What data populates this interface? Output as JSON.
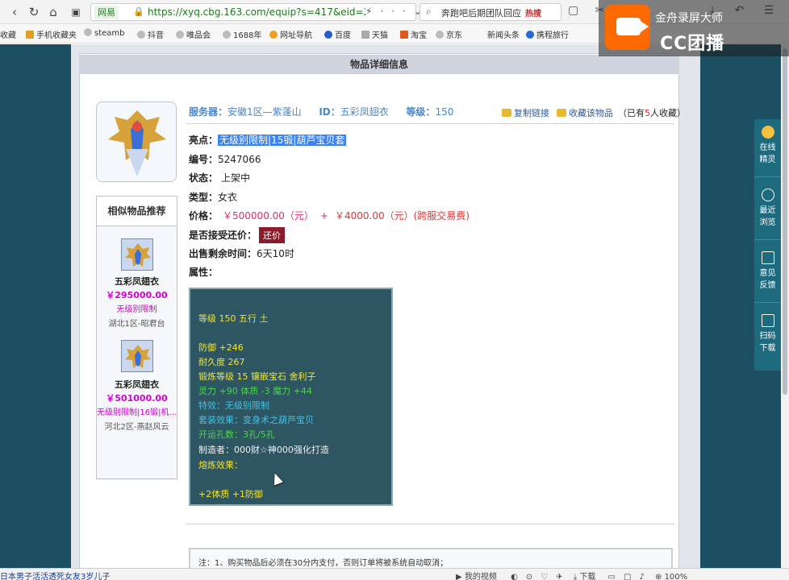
{
  "browser": {
    "url_site": "网易",
    "url": "https://xyq.cbg.163.com/equip?s=417&eid=2",
    "search_text": "奔跑吧后期团队回应",
    "search_hot": "热搜",
    "back_icon": "‹",
    "refresh_icon": "↻",
    "home_icon": "⌂"
  },
  "bookmarks": [
    {
      "label": "收藏",
      "color": "#666"
    },
    {
      "label": "手机收藏夹",
      "color": "#e0a020"
    },
    {
      "label": "steamb",
      "color": "#777"
    },
    {
      "label": "抖音",
      "color": "#777"
    },
    {
      "label": "唯品会",
      "color": "#777"
    },
    {
      "label": "1688年",
      "color": "#777"
    },
    {
      "label": "网址导航",
      "color": "#f0a020"
    },
    {
      "label": "百度",
      "color": "#2a5ad0"
    },
    {
      "label": "天猫",
      "color": "#888"
    },
    {
      "label": "淘宝",
      "color": "#e05a20"
    },
    {
      "label": "京东",
      "color": "#777"
    },
    {
      "label": "新闻头条",
      "color": "#777"
    },
    {
      "label": "携程旅行",
      "color": "#2a6ad0"
    }
  ],
  "recorder": {
    "title": "金舟录屏大师",
    "brand": "CC团播"
  },
  "panel": {
    "title": "物品详细信息"
  },
  "item_header": {
    "server_label": "服务器：",
    "server_value": "安徽1区—紫蓬山",
    "id_label": "ID：",
    "id_value": "五彩凤翅衣",
    "level_label": "等级：",
    "level_value": "150",
    "copy_link": "复制链接",
    "favorite": "收藏该物品",
    "fav_prefix": "（已有",
    "fav_count": "5",
    "fav_suffix": "人收藏）"
  },
  "details": {
    "highlight_label": "亮点：",
    "highlight_value": "无级别限制|15锻|葫芦宝贝套",
    "number_label": "编号：",
    "number_value": "5247066",
    "status_label": "状态：",
    "status_value": "上架中",
    "type_label": "类型：",
    "type_value": "女衣",
    "price_label": "价格：",
    "price_value": "￥500000.00（元）",
    "price_plus": "+",
    "price_fee": "￥4000.00（元）(跨服交易费)",
    "counter_label": "是否接受还价：",
    "counter_button": "还价",
    "remaining_label": "出售剩余时间：",
    "remaining_value": "6天10时",
    "attr_label": "属性："
  },
  "attributes": [
    {
      "text": "等级 150 五行 土",
      "color": "y"
    },
    {
      "text": "防御 +246",
      "color": "y"
    },
    {
      "text": "耐久度 267",
      "color": "y"
    },
    {
      "text": "锻炼等级 15 镶嵌宝石 舍利子",
      "color": "y"
    },
    {
      "text": "灵力 +90 体质 -3 魔力 +44",
      "color": "g"
    },
    {
      "text": "特效：无级别限制",
      "color": "c"
    },
    {
      "text": "套装效果：变身术之葫芦宝贝",
      "color": "c"
    },
    {
      "text": "开运孔数：3孔/5孔",
      "color": "g"
    },
    {
      "text": "制造者：000财☆神000强化打造",
      "color": "w"
    },
    {
      "text": "熔炼效果：",
      "color": "y"
    },
    {
      "text": "+2体质 +1防御",
      "color": "y"
    }
  ],
  "similar": {
    "title": "相似物品推荐",
    "items": [
      {
        "name": "五彩凤翅衣",
        "price": "￥295000.00",
        "tag": "无级别限制",
        "server": "湖北1区-昭君台"
      },
      {
        "name": "五彩凤翅衣",
        "price": "￥501000.00",
        "tag": "无级别限制|16锻|机…",
        "server": "河北2区-燕赵风云"
      }
    ]
  },
  "notice": "注：1、购买物品后必须在30分内支付，否则订单将被系统自动取消；",
  "side_panel": [
    {
      "label1": "在线",
      "label2": "精灵"
    },
    {
      "label1": "最近",
      "label2": "浏览"
    },
    {
      "label1": "意见",
      "label2": "反馈"
    },
    {
      "label1": "扫码",
      "label2": "下载"
    }
  ],
  "status_bar": {
    "left": "日本男子活活透死女友3岁儿子",
    "video": "我的视频",
    "download": "下载",
    "zoom": "100%"
  },
  "colors": {
    "page_bg": "#1b4f61",
    "attr_bg": "#2e5562",
    "price": "#e02d6a",
    "link": "#4a86c8"
  }
}
